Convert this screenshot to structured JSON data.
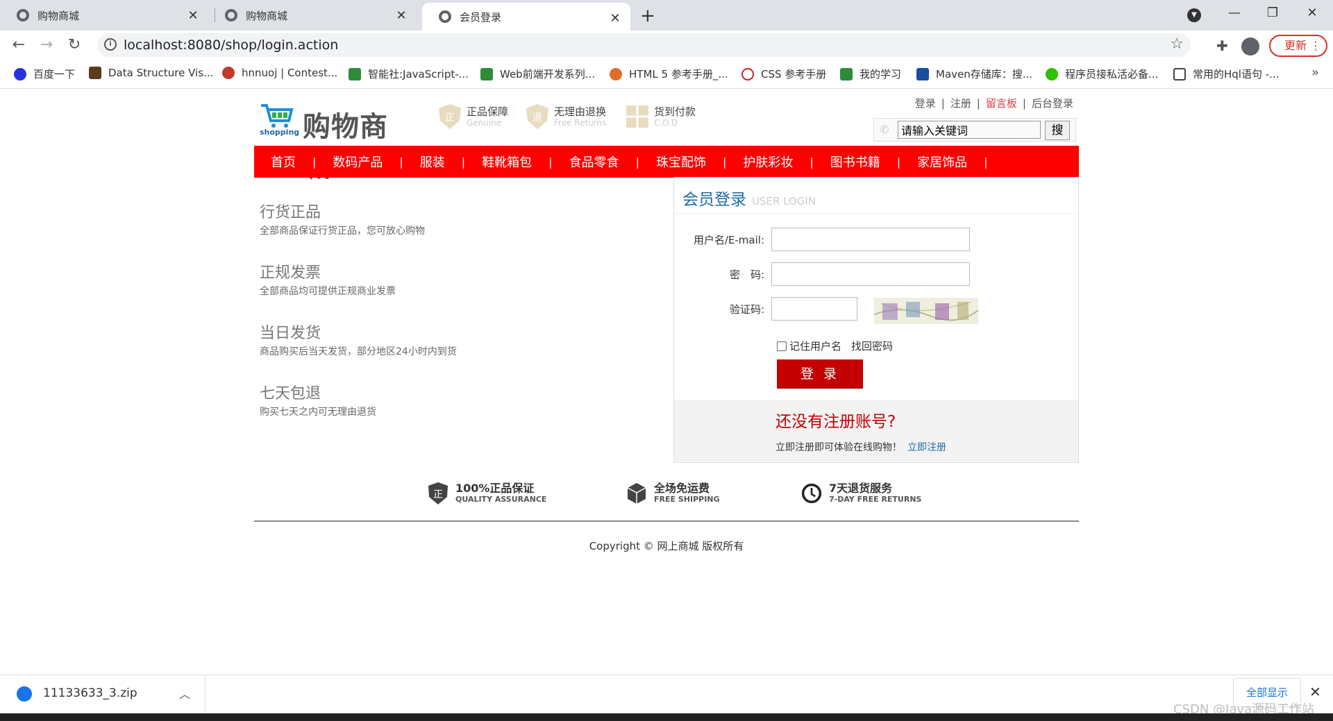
{
  "browser": {
    "tabs": [
      {
        "title": "购物商城"
      },
      {
        "title": "购物商城"
      },
      {
        "title": "会员登录"
      }
    ],
    "url": "localhost:8080/shop/login.action",
    "update_label": "更新",
    "bookmarks": [
      "百度一下",
      "Data Structure Vis...",
      "hnnuoj | Contest...",
      "智能社:JavaScript-...",
      "Web前端开发系列...",
      "HTML 5 参考手册_...",
      "CSS 参考手册",
      "我的学习",
      "Maven存储库：搜...",
      "程序员接私活必备...",
      "常用的Hql语句 -..."
    ],
    "bookmarks_more": "»"
  },
  "site": {
    "logo_title": "购物商城",
    "logo_sub": "shopping",
    "badges": [
      {
        "title": "正品保障",
        "sub": "Genuine"
      },
      {
        "title": "无理由退换",
        "sub": "Free Returns"
      },
      {
        "title": "货到付款",
        "sub": "C.O.D"
      }
    ],
    "top_links": {
      "login": "登录",
      "register": "注册",
      "guestbook": "留言板",
      "admin_login": "后台登录",
      "sep": "|"
    },
    "search": {
      "value": "请输入关键词",
      "button": "搜"
    },
    "menu": [
      "首页",
      "数码产品",
      "服装",
      "鞋靴箱包",
      "食品零食",
      "珠宝配饰",
      "护肤彩妆",
      "图书书籍",
      "家居饰品"
    ],
    "menu_sep": "|",
    "features": [
      {
        "title": "行货正品",
        "desc": "全部商品保证行货正品，您可放心购物"
      },
      {
        "title": "正规发票",
        "desc": "全部商品均可提供正规商业发票"
      },
      {
        "title": "当日发货",
        "desc": "商品购买后当天发货，部分地区24小时内到货"
      },
      {
        "title": "七天包退",
        "desc": "购买七天之内可无理由退货"
      }
    ],
    "login": {
      "title": "会员登录",
      "subtitle": "USER LOGIN",
      "username_label": "用户名/E-mail:",
      "password_label": "密　码:",
      "captcha_label": "验证码:",
      "remember_label": "记住用户名",
      "forgot_label": "找回密码",
      "submit_label": "登 录",
      "register_title": "还没有注册账号?",
      "register_text": "立即注册即可体验在线购物！",
      "register_link": "立即注册"
    },
    "services": [
      {
        "title": "100%正品保证",
        "sub": "QUALITY ASSURANCE"
      },
      {
        "title": "全场免运费",
        "sub": "FREE SHIPPING"
      },
      {
        "title": "7天退货服务",
        "sub": "7-DAY FREE RETURNS"
      }
    ],
    "copyright": "Copyright © 网上商城 版权所有"
  },
  "downloads": {
    "file": "11133633_3.zip",
    "show_all": "全部显示"
  },
  "watermark": "CSDN @Java源码工作站"
}
